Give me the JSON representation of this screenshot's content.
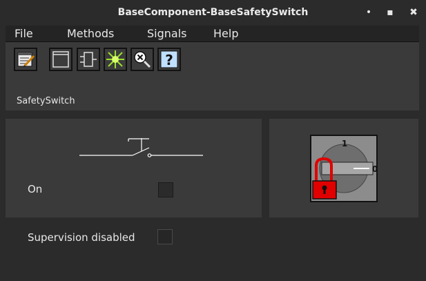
{
  "window": {
    "title": "BaseComponent-BaseSafetySwitch",
    "minimize_glyph": "•",
    "maximize_glyph": "▪",
    "close_glyph": "✖"
  },
  "menu": {
    "items": [
      {
        "label": "File"
      },
      {
        "label": "Methods"
      },
      {
        "label": "Signals"
      },
      {
        "label": "Help"
      }
    ]
  },
  "toolbar": {
    "buttons": [
      {
        "icon": "notepad-pen-icon"
      },
      {
        "icon": "window-icon"
      },
      {
        "icon": "component-icon"
      },
      {
        "icon": "star-burst-icon"
      },
      {
        "icon": "magnifier-x-icon"
      },
      {
        "icon": "help-icon",
        "glyph": "?"
      }
    ],
    "object_name": "SafetySwitch"
  },
  "signals": {
    "on_label": "On",
    "supervision_label": "Supervision disabled"
  },
  "switch_graphic": {
    "position_1": "1",
    "position_0": "0",
    "lock_color": "#e00000",
    "plate_color": "#8c8c8c"
  }
}
